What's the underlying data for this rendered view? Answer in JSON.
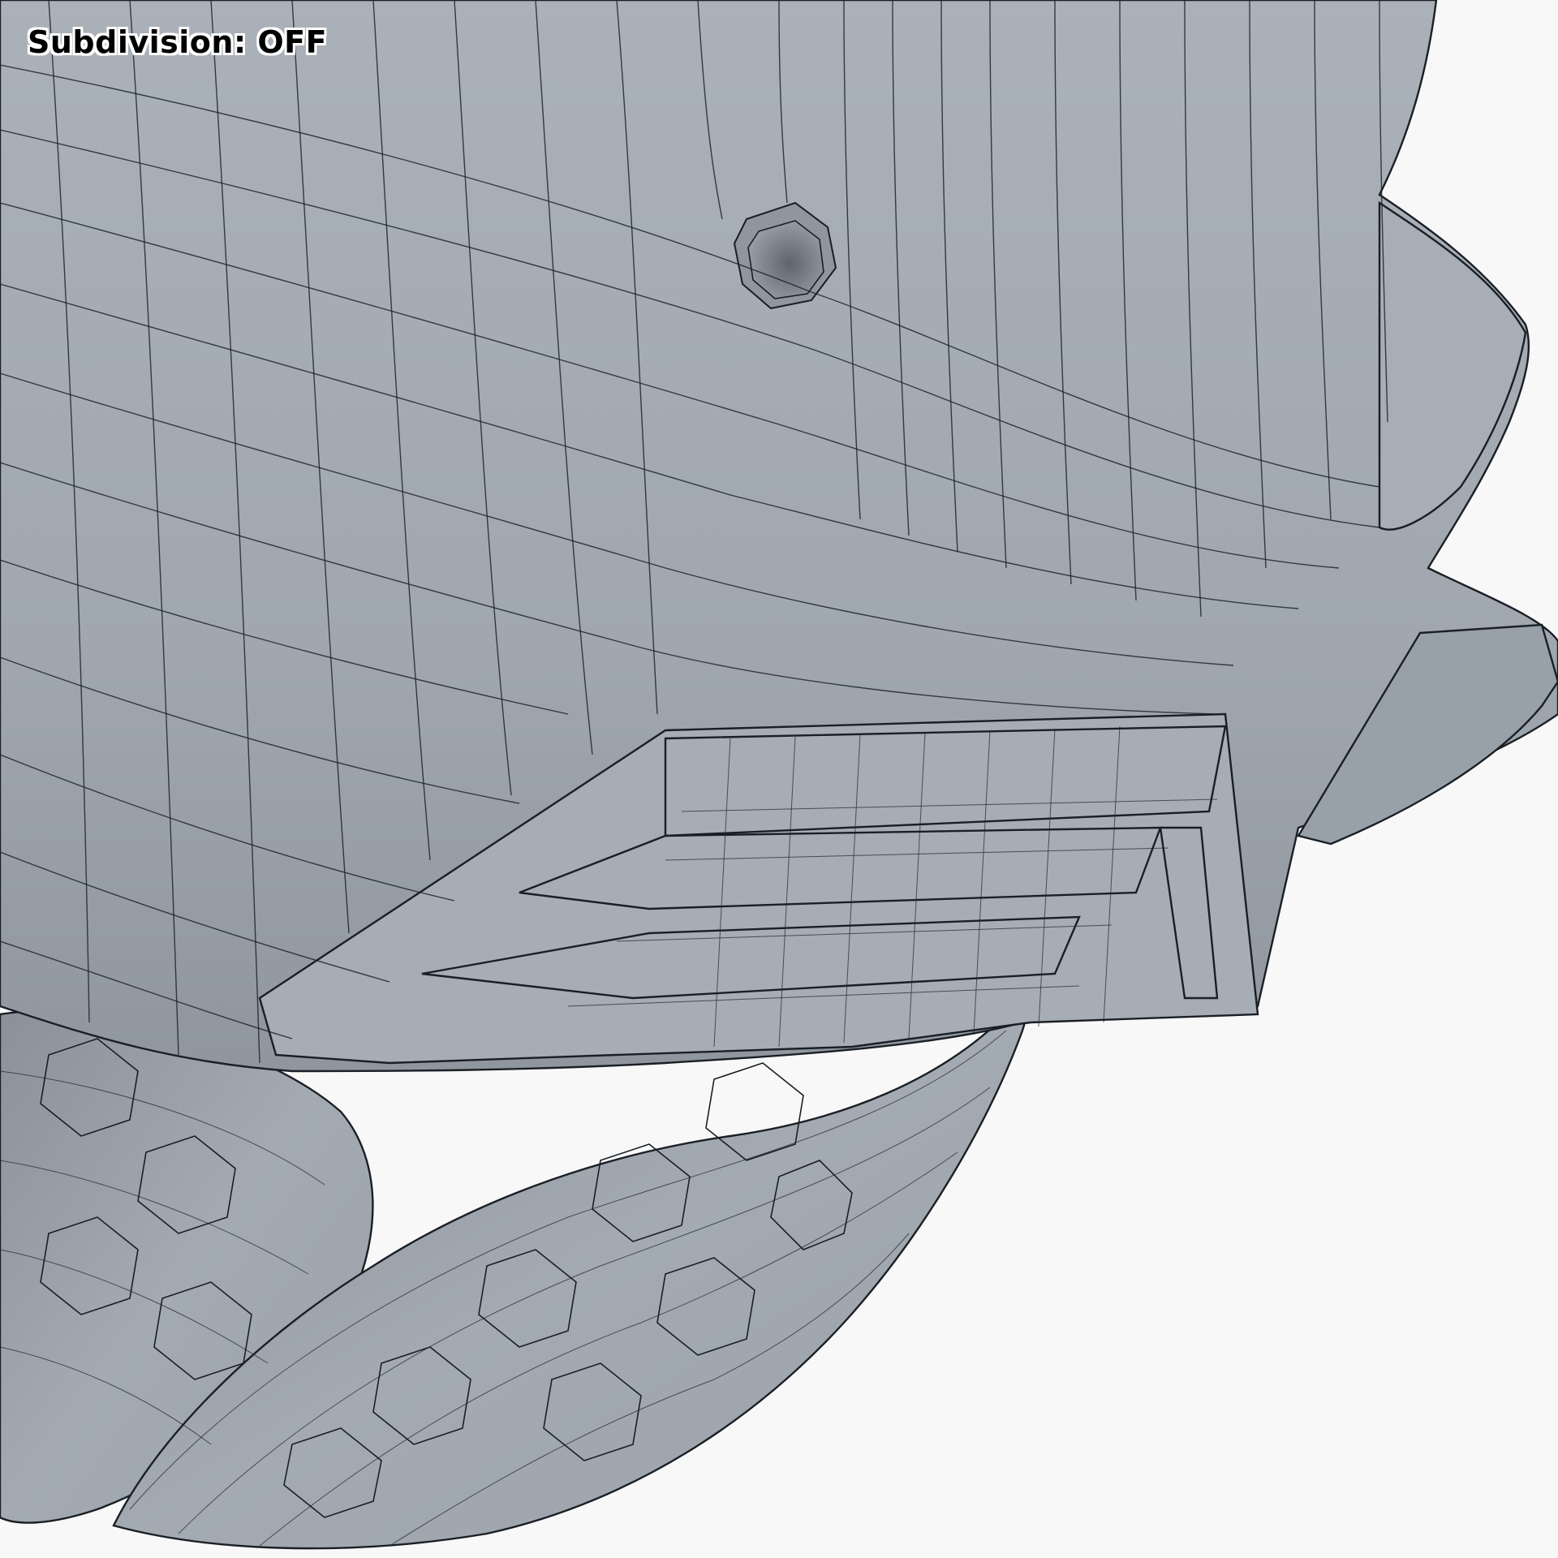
{
  "viewport": {
    "overlay_label": "Subdivision: OFF",
    "subject": "wireframe-mesh-render",
    "colors": {
      "background": "#f8f8f8",
      "mesh_fill": "#a2a9b1",
      "mesh_shadow": "#7f8790",
      "wire": "#1e242b"
    }
  }
}
